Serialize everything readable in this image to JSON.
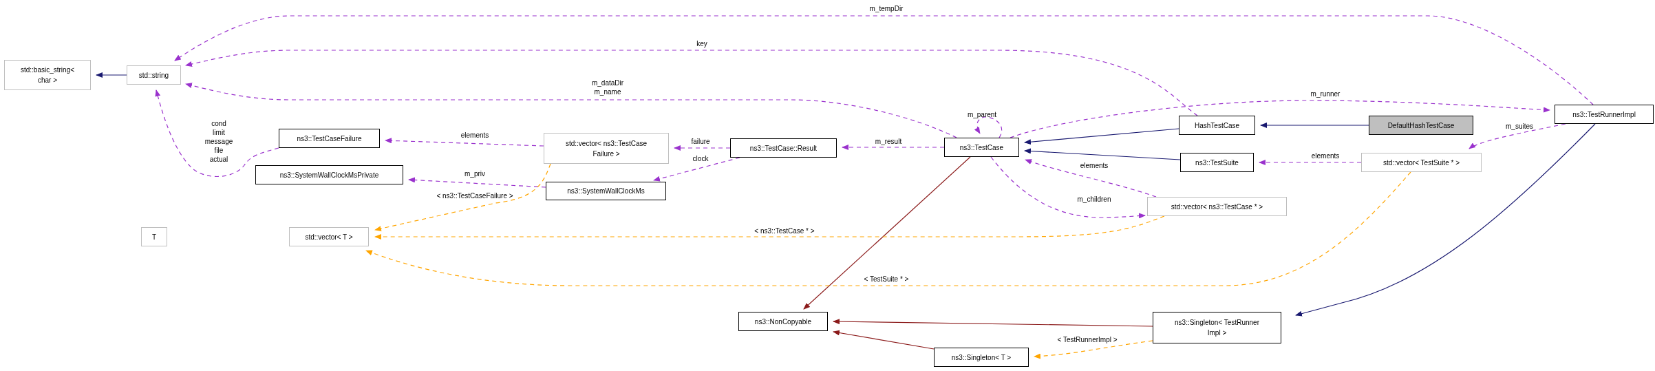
{
  "diagram": {
    "nodes": [
      {
        "lines": [
          "std::basic_string<",
          "char >"
        ],
        "documented": false,
        "selected": false
      },
      {
        "lines": [
          "std::string"
        ],
        "documented": false,
        "selected": false
      },
      {
        "lines": [
          "ns3::TestCaseFailure"
        ],
        "documented": true,
        "selected": false
      },
      {
        "lines": [
          "ns3::SystemWallClockMsPrivate"
        ],
        "documented": true,
        "selected": false
      },
      {
        "lines": [
          "std::vector< ns3::TestCase",
          "Failure >"
        ],
        "documented": false,
        "selected": false
      },
      {
        "lines": [
          "ns3::SystemWallClockMs"
        ],
        "documented": true,
        "selected": false
      },
      {
        "lines": [
          "ns3::TestCase::Result"
        ],
        "documented": true,
        "selected": false
      },
      {
        "lines": [
          "ns3::TestCase"
        ],
        "documented": true,
        "selected": false
      },
      {
        "lines": [
          "HashTestCase"
        ],
        "documented": true,
        "selected": false
      },
      {
        "lines": [
          "DefaultHashTestCase"
        ],
        "documented": true,
        "selected": true
      },
      {
        "lines": [
          "ns3::TestRunnerImpl"
        ],
        "documented": true,
        "selected": false
      },
      {
        "lines": [
          "ns3::TestSuite"
        ],
        "documented": true,
        "selected": false
      },
      {
        "lines": [
          "std::vector< TestSuite * >"
        ],
        "documented": false,
        "selected": false
      },
      {
        "lines": [
          "std::vector< ns3::TestCase * >"
        ],
        "documented": false,
        "selected": false
      },
      {
        "lines": [
          "T"
        ],
        "documented": false,
        "selected": false
      },
      {
        "lines": [
          "std::vector< T >"
        ],
        "documented": false,
        "selected": false
      },
      {
        "lines": [
          "ns3::NonCopyable"
        ],
        "documented": true,
        "selected": false
      },
      {
        "lines": [
          "ns3::Singleton< T >"
        ],
        "documented": true,
        "selected": false
      },
      {
        "lines": [
          "ns3::Singleton< TestRunner",
          "Impl >"
        ],
        "documented": true,
        "selected": false
      }
    ],
    "edges": [
      {
        "kind": "usage",
        "labels": [
          "m_tempDir"
        ]
      },
      {
        "kind": "usage",
        "labels": [
          "key"
        ]
      },
      {
        "kind": "usage",
        "labels": [
          "m_dataDir",
          "m_name"
        ]
      },
      {
        "kind": "usage",
        "labels": [
          "cond",
          "limit",
          "message",
          "file",
          "actual"
        ]
      },
      {
        "kind": "usage",
        "labels": [
          "elements"
        ]
      },
      {
        "kind": "usage",
        "labels": [
          "m_priv"
        ]
      },
      {
        "kind": "usage",
        "labels": [
          "failure"
        ]
      },
      {
        "kind": "usage",
        "labels": [
          "clock"
        ]
      },
      {
        "kind": "usage",
        "labels": [
          "m_result"
        ]
      },
      {
        "kind": "usage",
        "labels": [
          "m_parent"
        ]
      },
      {
        "kind": "usage",
        "labels": [
          "m_runner"
        ]
      },
      {
        "kind": "public"
      },
      {
        "kind": "public"
      },
      {
        "kind": "public"
      },
      {
        "kind": "usage",
        "labels": [
          "elements"
        ]
      },
      {
        "kind": "usage",
        "labels": [
          "m_children"
        ]
      },
      {
        "kind": "usage",
        "labels": [
          "elements"
        ]
      },
      {
        "kind": "usage",
        "labels": [
          "m_suites"
        ]
      },
      {
        "kind": "private"
      },
      {
        "kind": "private"
      },
      {
        "kind": "private"
      },
      {
        "kind": "public"
      },
      {
        "kind": "template",
        "labels": [
          "< ns3::TestCaseFailure >"
        ]
      },
      {
        "kind": "template",
        "labels": [
          "< ns3::TestCase * >"
        ]
      },
      {
        "kind": "template",
        "labels": [
          "< TestSuite * >"
        ]
      },
      {
        "kind": "template",
        "labels": [
          "< TestRunnerImpl >"
        ]
      },
      {
        "kind": "public"
      }
    ]
  }
}
